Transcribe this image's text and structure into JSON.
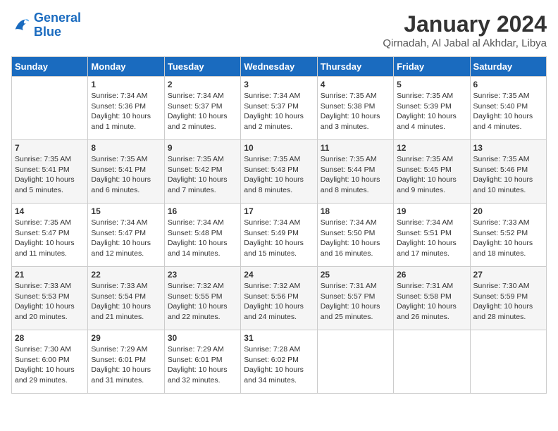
{
  "logo": {
    "text_general": "General",
    "text_blue": "Blue"
  },
  "title": {
    "month_year": "January 2024",
    "location": "Qirnadah, Al Jabal al Akhdar, Libya"
  },
  "days_of_week": [
    "Sunday",
    "Monday",
    "Tuesday",
    "Wednesday",
    "Thursday",
    "Friday",
    "Saturday"
  ],
  "weeks": [
    [
      {
        "day": "",
        "info": ""
      },
      {
        "day": "1",
        "info": "Sunrise: 7:34 AM\nSunset: 5:36 PM\nDaylight: 10 hours\nand 1 minute."
      },
      {
        "day": "2",
        "info": "Sunrise: 7:34 AM\nSunset: 5:37 PM\nDaylight: 10 hours\nand 2 minutes."
      },
      {
        "day": "3",
        "info": "Sunrise: 7:34 AM\nSunset: 5:37 PM\nDaylight: 10 hours\nand 2 minutes."
      },
      {
        "day": "4",
        "info": "Sunrise: 7:35 AM\nSunset: 5:38 PM\nDaylight: 10 hours\nand 3 minutes."
      },
      {
        "day": "5",
        "info": "Sunrise: 7:35 AM\nSunset: 5:39 PM\nDaylight: 10 hours\nand 4 minutes."
      },
      {
        "day": "6",
        "info": "Sunrise: 7:35 AM\nSunset: 5:40 PM\nDaylight: 10 hours\nand 4 minutes."
      }
    ],
    [
      {
        "day": "7",
        "info": "Sunrise: 7:35 AM\nSunset: 5:41 PM\nDaylight: 10 hours\nand 5 minutes."
      },
      {
        "day": "8",
        "info": "Sunrise: 7:35 AM\nSunset: 5:41 PM\nDaylight: 10 hours\nand 6 minutes."
      },
      {
        "day": "9",
        "info": "Sunrise: 7:35 AM\nSunset: 5:42 PM\nDaylight: 10 hours\nand 7 minutes."
      },
      {
        "day": "10",
        "info": "Sunrise: 7:35 AM\nSunset: 5:43 PM\nDaylight: 10 hours\nand 8 minutes."
      },
      {
        "day": "11",
        "info": "Sunrise: 7:35 AM\nSunset: 5:44 PM\nDaylight: 10 hours\nand 8 minutes."
      },
      {
        "day": "12",
        "info": "Sunrise: 7:35 AM\nSunset: 5:45 PM\nDaylight: 10 hours\nand 9 minutes."
      },
      {
        "day": "13",
        "info": "Sunrise: 7:35 AM\nSunset: 5:46 PM\nDaylight: 10 hours\nand 10 minutes."
      }
    ],
    [
      {
        "day": "14",
        "info": "Sunrise: 7:35 AM\nSunset: 5:47 PM\nDaylight: 10 hours\nand 11 minutes."
      },
      {
        "day": "15",
        "info": "Sunrise: 7:34 AM\nSunset: 5:47 PM\nDaylight: 10 hours\nand 12 minutes."
      },
      {
        "day": "16",
        "info": "Sunrise: 7:34 AM\nSunset: 5:48 PM\nDaylight: 10 hours\nand 14 minutes."
      },
      {
        "day": "17",
        "info": "Sunrise: 7:34 AM\nSunset: 5:49 PM\nDaylight: 10 hours\nand 15 minutes."
      },
      {
        "day": "18",
        "info": "Sunrise: 7:34 AM\nSunset: 5:50 PM\nDaylight: 10 hours\nand 16 minutes."
      },
      {
        "day": "19",
        "info": "Sunrise: 7:34 AM\nSunset: 5:51 PM\nDaylight: 10 hours\nand 17 minutes."
      },
      {
        "day": "20",
        "info": "Sunrise: 7:33 AM\nSunset: 5:52 PM\nDaylight: 10 hours\nand 18 minutes."
      }
    ],
    [
      {
        "day": "21",
        "info": "Sunrise: 7:33 AM\nSunset: 5:53 PM\nDaylight: 10 hours\nand 20 minutes."
      },
      {
        "day": "22",
        "info": "Sunrise: 7:33 AM\nSunset: 5:54 PM\nDaylight: 10 hours\nand 21 minutes."
      },
      {
        "day": "23",
        "info": "Sunrise: 7:32 AM\nSunset: 5:55 PM\nDaylight: 10 hours\nand 22 minutes."
      },
      {
        "day": "24",
        "info": "Sunrise: 7:32 AM\nSunset: 5:56 PM\nDaylight: 10 hours\nand 24 minutes."
      },
      {
        "day": "25",
        "info": "Sunrise: 7:31 AM\nSunset: 5:57 PM\nDaylight: 10 hours\nand 25 minutes."
      },
      {
        "day": "26",
        "info": "Sunrise: 7:31 AM\nSunset: 5:58 PM\nDaylight: 10 hours\nand 26 minutes."
      },
      {
        "day": "27",
        "info": "Sunrise: 7:30 AM\nSunset: 5:59 PM\nDaylight: 10 hours\nand 28 minutes."
      }
    ],
    [
      {
        "day": "28",
        "info": "Sunrise: 7:30 AM\nSunset: 6:00 PM\nDaylight: 10 hours\nand 29 minutes."
      },
      {
        "day": "29",
        "info": "Sunrise: 7:29 AM\nSunset: 6:01 PM\nDaylight: 10 hours\nand 31 minutes."
      },
      {
        "day": "30",
        "info": "Sunrise: 7:29 AM\nSunset: 6:01 PM\nDaylight: 10 hours\nand 32 minutes."
      },
      {
        "day": "31",
        "info": "Sunrise: 7:28 AM\nSunset: 6:02 PM\nDaylight: 10 hours\nand 34 minutes."
      },
      {
        "day": "",
        "info": ""
      },
      {
        "day": "",
        "info": ""
      },
      {
        "day": "",
        "info": ""
      }
    ]
  ]
}
